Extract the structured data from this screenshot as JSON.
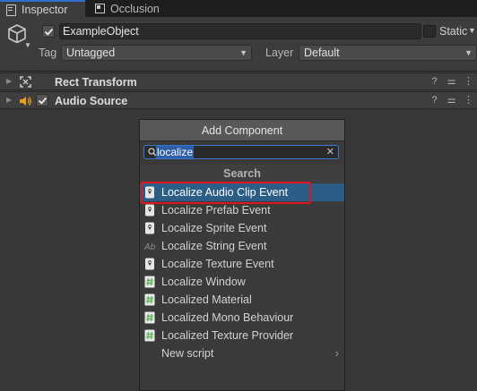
{
  "tabs": [
    {
      "label": "Inspector",
      "icon": "inspector-icon",
      "active": true
    },
    {
      "label": "Occlusion",
      "icon": "occlusion-icon",
      "active": false
    }
  ],
  "header": {
    "object_name": "ExampleObject",
    "active_checked": true,
    "static_label": "Static",
    "static_checked": false,
    "tag_label": "Tag",
    "tag_value": "Untagged",
    "layer_label": "Layer",
    "layer_value": "Default"
  },
  "components": [
    {
      "title": "Rect Transform",
      "icon": "rect-transform-icon",
      "has_checkbox": false
    },
    {
      "title": "Audio Source",
      "icon": "audio-source-icon",
      "has_checkbox": true,
      "enabled": true
    }
  ],
  "add_component": {
    "title": "Add Component",
    "search_value": "localize",
    "section_header": "Search",
    "items": [
      {
        "label": "Localize Audio Clip Event",
        "icon": "localize-event-icon",
        "selected": true
      },
      {
        "label": "Localize Prefab Event",
        "icon": "localize-event-icon",
        "selected": false
      },
      {
        "label": "Localize Sprite Event",
        "icon": "localize-event-icon",
        "selected": false
      },
      {
        "label": "Localize String Event",
        "icon": "localize-string-event-icon",
        "selected": false
      },
      {
        "label": "Localize Texture Event",
        "icon": "localize-event-icon",
        "selected": false
      },
      {
        "label": "Localize Window",
        "icon": "script-icon",
        "selected": false
      },
      {
        "label": "Localized Material",
        "icon": "script-icon",
        "selected": false
      },
      {
        "label": "Localized Mono Behaviour",
        "icon": "script-icon",
        "selected": false
      },
      {
        "label": "Localized Texture Provider",
        "icon": "script-icon",
        "selected": false
      },
      {
        "label": "New script",
        "icon": "",
        "selected": false,
        "has_submenu": true
      }
    ]
  },
  "colors": {
    "selection": "#2c5d87",
    "annotation_highlight": "#e0141e",
    "tab_accent": "#2f6fd0",
    "script_icon_green": "#5fb65f"
  }
}
